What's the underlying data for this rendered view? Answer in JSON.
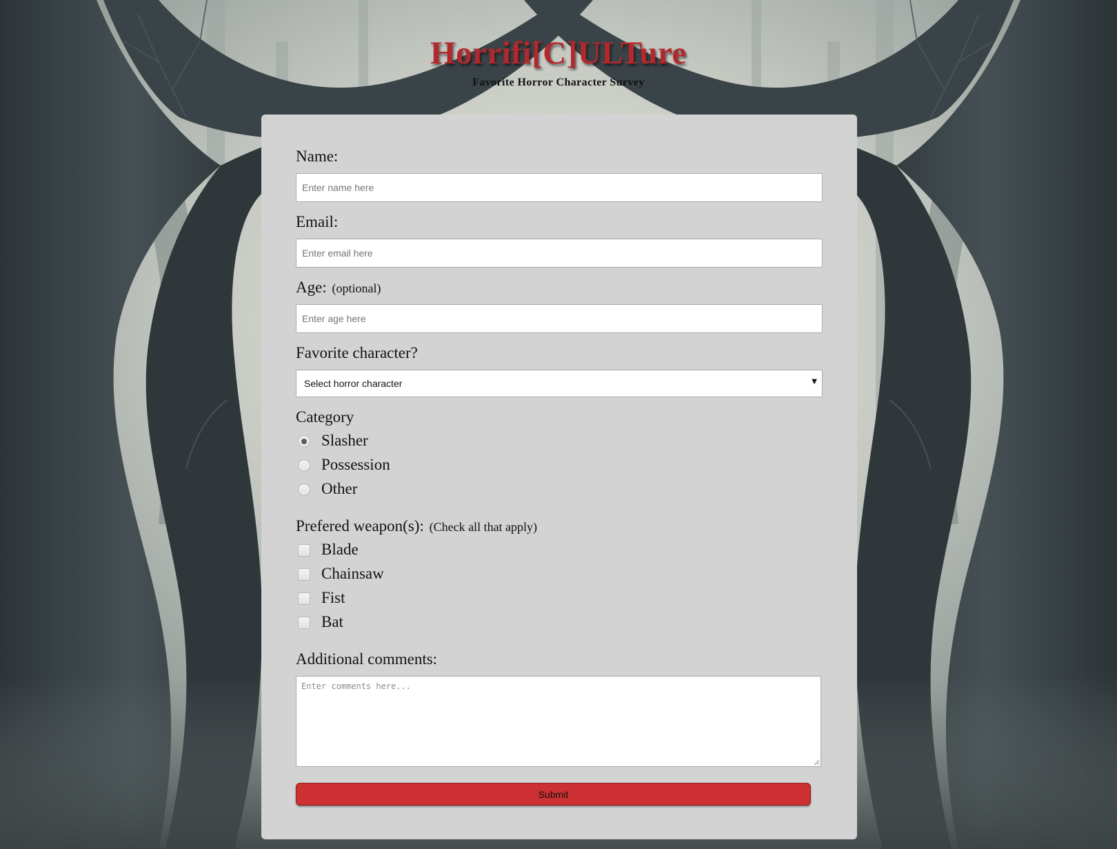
{
  "header": {
    "title": "Horrifi[C]ULTure",
    "subtitle": "Favorite Horror Character Survey"
  },
  "form": {
    "name": {
      "label": "Name:",
      "placeholder": "Enter name here",
      "value": ""
    },
    "email": {
      "label": "Email:",
      "placeholder": "Enter email here",
      "value": ""
    },
    "age": {
      "label": "Age:",
      "hint": "(optional)",
      "placeholder": "Enter age here",
      "value": ""
    },
    "character": {
      "label": "Favorite character?",
      "selected": "Select horror character"
    },
    "category": {
      "label": "Category",
      "options": [
        {
          "label": "Slasher",
          "checked": true
        },
        {
          "label": "Possession",
          "checked": false
        },
        {
          "label": "Other",
          "checked": false
        }
      ]
    },
    "weapons": {
      "label": "Prefered weapon(s):",
      "hint": "(Check all that apply)",
      "options": [
        {
          "label": "Blade",
          "checked": false
        },
        {
          "label": "Chainsaw",
          "checked": false
        },
        {
          "label": "Fist",
          "checked": false
        },
        {
          "label": "Bat",
          "checked": false
        }
      ]
    },
    "comments": {
      "label": "Additional comments:",
      "placeholder": "Enter comments here...",
      "value": ""
    },
    "submit_label": "Submit"
  },
  "colors": {
    "title": "#b3282d",
    "card_background": "#d3d3d3",
    "submit_background": "#cd3033",
    "submit_border": "#8f1e20"
  },
  "icons": {
    "select_caret": "triangle-down-icon",
    "textarea_resize": "resize-grip-icon"
  }
}
